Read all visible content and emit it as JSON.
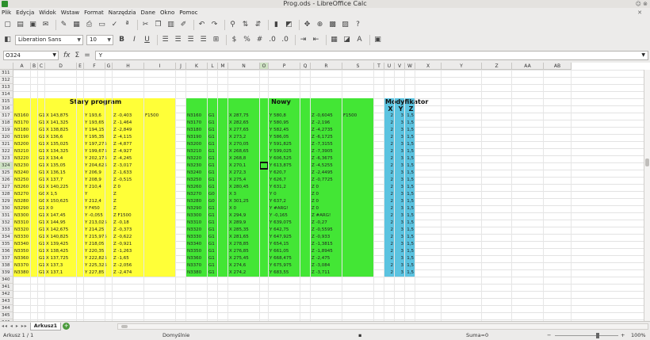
{
  "window": {
    "title": "Prog.ods - LibreOffice Calc",
    "buttons": "☺ ⊗"
  },
  "menu": [
    "Plik",
    "Edycja",
    "Widok",
    "Wstaw",
    "Format",
    "Narzędzia",
    "Dane",
    "Okno",
    "Pomoc"
  ],
  "toolbar": {
    "font_name": "Liberation Sans",
    "font_size": "10",
    "bold": "B",
    "italic": "I",
    "underline": "U"
  },
  "formula_bar": {
    "cell_ref": "O324",
    "sum_symbol": "Σ",
    "equals_symbol": "=",
    "content": "Y"
  },
  "columns": [
    "A",
    "B",
    "C",
    "D",
    "E",
    "F",
    "G",
    "H",
    "I",
    "J",
    "K",
    "L",
    "M",
    "N",
    "O",
    "P",
    "Q",
    "R",
    "S",
    "T",
    "U",
    "V",
    "W",
    "X",
    "Y",
    "Z",
    "AA",
    "AB"
  ],
  "selected_column": "O",
  "rows": [
    311,
    312,
    313,
    314,
    315,
    316,
    317,
    318,
    319,
    320,
    321,
    322,
    323,
    324,
    325,
    326,
    327,
    328,
    329,
    330,
    331,
    332,
    333,
    334,
    335,
    336,
    337,
    338,
    339,
    340,
    341,
    342,
    343,
    344,
    345,
    346,
    347,
    348
  ],
  "selected_row": 324,
  "stary": {
    "title": "Stary program",
    "extra": "F1500",
    "rows": [
      [
        "N3160",
        "G1",
        "X 143,875",
        "Y 193,6",
        "Z -0,403"
      ],
      [
        "N3170",
        "G1",
        "X 141,325",
        "Y 193,65",
        "Z -1,464"
      ],
      [
        "N3180",
        "G1",
        "X 138,825",
        "Y 194,15",
        "Z -2,849"
      ],
      [
        "N3190",
        "G1",
        "X 136,6",
        "Y 195,35",
        "Z -4,115"
      ],
      [
        "N3200",
        "G1",
        "X 135,025",
        "Y 197,275",
        "Z -4,877"
      ],
      [
        "N3210",
        "G1",
        "X 134,325",
        "Y 199,675",
        "Z -4,927"
      ],
      [
        "N3220",
        "G1",
        "X 134,4",
        "Y 202,175",
        "Z -4,245"
      ],
      [
        "N3230",
        "G1",
        "X 135,05",
        "Y 204,625",
        "Z -3,017"
      ],
      [
        "N3240",
        "G1",
        "X 136,15",
        "Y 206,9",
        "Z -1,633"
      ],
      [
        "N3250",
        "G1",
        "X 137,7",
        "Y 208,9",
        "Z -0,515"
      ],
      [
        "N3260",
        "G1",
        "X 140,225",
        "Y 210,4",
        "Z 0"
      ],
      [
        "N3270",
        "G0",
        "X 1,5",
        "Y",
        "Z"
      ],
      [
        "N3280",
        "G0",
        "X 150,625",
        "Y 212,4",
        "Z"
      ],
      [
        "N3290",
        "G1",
        "X 0",
        "Y F450",
        "Z"
      ],
      [
        "N3300",
        "G1",
        "X 147,45",
        "Y -0,055",
        "Z F1500"
      ],
      [
        "N3310",
        "G1",
        "X 144,95",
        "Y 213,025",
        "Z -0,18"
      ],
      [
        "N3320",
        "G1",
        "X 142,675",
        "Y 214,25",
        "Z -0,373"
      ],
      [
        "N3330",
        "G1",
        "X 140,825",
        "Y 215,975",
        "Z -0,622"
      ],
      [
        "N3340",
        "G1",
        "X 139,425",
        "Y 218,05",
        "Z -0,921"
      ],
      [
        "N3350",
        "G1",
        "X 138,425",
        "Y 220,35",
        "Z -1,263"
      ],
      [
        "N3360",
        "G1",
        "X 137,725",
        "Y 222,825",
        "Z -1,65"
      ],
      [
        "N3370",
        "G1",
        "X 137,3",
        "Y 225,325",
        "Z -2,056"
      ],
      [
        "N3380",
        "G1",
        "X 137,1",
        "Y 227,85",
        "Z -2,474"
      ]
    ]
  },
  "nowy": {
    "title": "Nowy",
    "extra": "F1500",
    "rows": [
      [
        "N3160",
        "G1",
        "X 287,75",
        "Y 580,8",
        "Z -0,6045"
      ],
      [
        "N3170",
        "G1",
        "X 282,65",
        "Y 580,95",
        "Z -2,196"
      ],
      [
        "N3180",
        "G1",
        "X 277,65",
        "Y 582,45",
        "Z -4,2735"
      ],
      [
        "N3190",
        "G1",
        "X 273,2",
        "Y 586,05",
        "Z -6,1725"
      ],
      [
        "N3200",
        "G1",
        "X 270,05",
        "Y 591,825",
        "Z -7,3155"
      ],
      [
        "N3210",
        "G1",
        "X 268,65",
        "Y 599,025",
        "Z -7,3905"
      ],
      [
        "N3220",
        "G1",
        "X 268,8",
        "Y 606,525",
        "Z -6,3675"
      ],
      [
        "N3230",
        "G1",
        "X 270,1",
        "Y 613,875",
        "Z -4,5255"
      ],
      [
        "N3240",
        "G1",
        "X 272,3",
        "Y 620,7",
        "Z -2,4495"
      ],
      [
        "N3250",
        "G1",
        "X 275,4",
        "Y 626,7",
        "Z -0,7725"
      ],
      [
        "N3260",
        "G1",
        "X 280,45",
        "Y 631,2",
        "Z 0"
      ],
      [
        "N3270",
        "G0",
        "X 3",
        "Y 0",
        "Z 0"
      ],
      [
        "N3280",
        "G0",
        "X 301,25",
        "Y 637,2",
        "Z 0"
      ],
      [
        "N3290",
        "G1",
        "X 0",
        "Y #ARG!",
        "Z 0"
      ],
      [
        "N3300",
        "G1",
        "X 294,9",
        "Y -0,165",
        "Z #ARG!"
      ],
      [
        "N3310",
        "G1",
        "X 289,9",
        "Y 639,075",
        "Z -0,27"
      ],
      [
        "N3320",
        "G1",
        "X 285,35",
        "Y 642,75",
        "Z -0,5595"
      ],
      [
        "N3330",
        "G1",
        "X 281,65",
        "Y 647,925",
        "Z -0,933"
      ],
      [
        "N3340",
        "G1",
        "X 278,85",
        "Y 654,15",
        "Z -1,3815"
      ],
      [
        "N3350",
        "G1",
        "X 276,85",
        "Y 661,05",
        "Z -1,8945"
      ],
      [
        "N3360",
        "G1",
        "X 275,45",
        "Y 668,475",
        "Z -2,475"
      ],
      [
        "N3370",
        "G1",
        "X 274,6",
        "Y 675,975",
        "Z -3,084"
      ],
      [
        "N3380",
        "G1",
        "X 274,2",
        "Y 683,55",
        "Z -3,711"
      ]
    ]
  },
  "modyfikator": {
    "title": "Modyfikator",
    "headers": [
      "X",
      "Y",
      "Z"
    ],
    "rows": [
      [
        "2",
        "3",
        "1,5"
      ],
      [
        "2",
        "3",
        "1,5"
      ],
      [
        "2",
        "3",
        "1,5"
      ],
      [
        "2",
        "3",
        "1,5"
      ],
      [
        "2",
        "3",
        "1,5"
      ],
      [
        "2",
        "3",
        "1,5"
      ],
      [
        "2",
        "3",
        "1,5"
      ],
      [
        "2",
        "3",
        "1,5"
      ],
      [
        "2",
        "3",
        "1,5"
      ],
      [
        "2",
        "3",
        "1,5"
      ],
      [
        "2",
        "3",
        "1,5"
      ],
      [
        "2",
        "3",
        "1,5"
      ],
      [
        "2",
        "3",
        "1,5"
      ],
      [
        "2",
        "3",
        "1,5"
      ],
      [
        "2",
        "3",
        "1,5"
      ],
      [
        "2",
        "3",
        "1,5"
      ],
      [
        "2",
        "3",
        "1,5"
      ],
      [
        "2",
        "3",
        "1,5"
      ],
      [
        "2",
        "3",
        "1,5"
      ],
      [
        "2",
        "3",
        "1,5"
      ],
      [
        "2",
        "3",
        "1,5"
      ],
      [
        "2",
        "3",
        "1,5"
      ],
      [
        "2",
        "3",
        "1,5"
      ]
    ]
  },
  "colors": {
    "stary": "#ffff38",
    "nowy": "#43e635",
    "modyfikator": "#5bc3e0"
  },
  "sheet_tab": "Arkusz1",
  "status": {
    "sheet": "Arkusz 1 / 1",
    "style": "Domyślnie",
    "sum": "Suma=0",
    "zoom": "100%"
  }
}
